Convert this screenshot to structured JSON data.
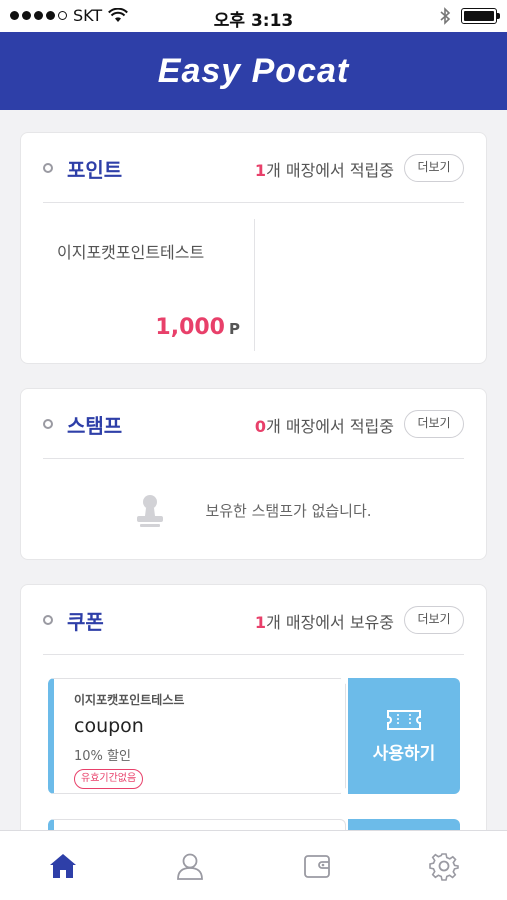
{
  "status_bar": {
    "carrier": "SKT",
    "time": "오후 3:13"
  },
  "header": {
    "logo_text": "Easy Pocat"
  },
  "points": {
    "title": "포인트",
    "count": "1",
    "summary_text": "개 매장에서 적립중",
    "more_label": "더보기",
    "items": [
      {
        "store": "이지포캣포인트테스트",
        "amount": "1,000",
        "unit": "P"
      }
    ]
  },
  "stamps": {
    "title": "스탬프",
    "count": "0",
    "summary_text": "개 매장에서 적립중",
    "more_label": "더보기",
    "empty_message": "보유한 스탬프가 없습니다."
  },
  "coupons": {
    "title": "쿠폰",
    "count": "1",
    "summary_text": "개 매장에서 보유중",
    "more_label": "더보기",
    "items": [
      {
        "store": "이지포캣포인트테스트",
        "name": "coupon",
        "discount": "10% 할인",
        "badge": "유효기간없음",
        "use_label": "사용하기"
      }
    ]
  },
  "tab_bar": {
    "items": [
      {
        "icon": "home-icon",
        "active": true
      },
      {
        "icon": "user-icon",
        "active": false
      },
      {
        "icon": "wallet-icon",
        "active": false
      },
      {
        "icon": "gear-icon",
        "active": false
      }
    ]
  },
  "colors": {
    "brand": "#2e3fa8",
    "accent": "#e8406a",
    "coupon": "#6cbbe9"
  }
}
